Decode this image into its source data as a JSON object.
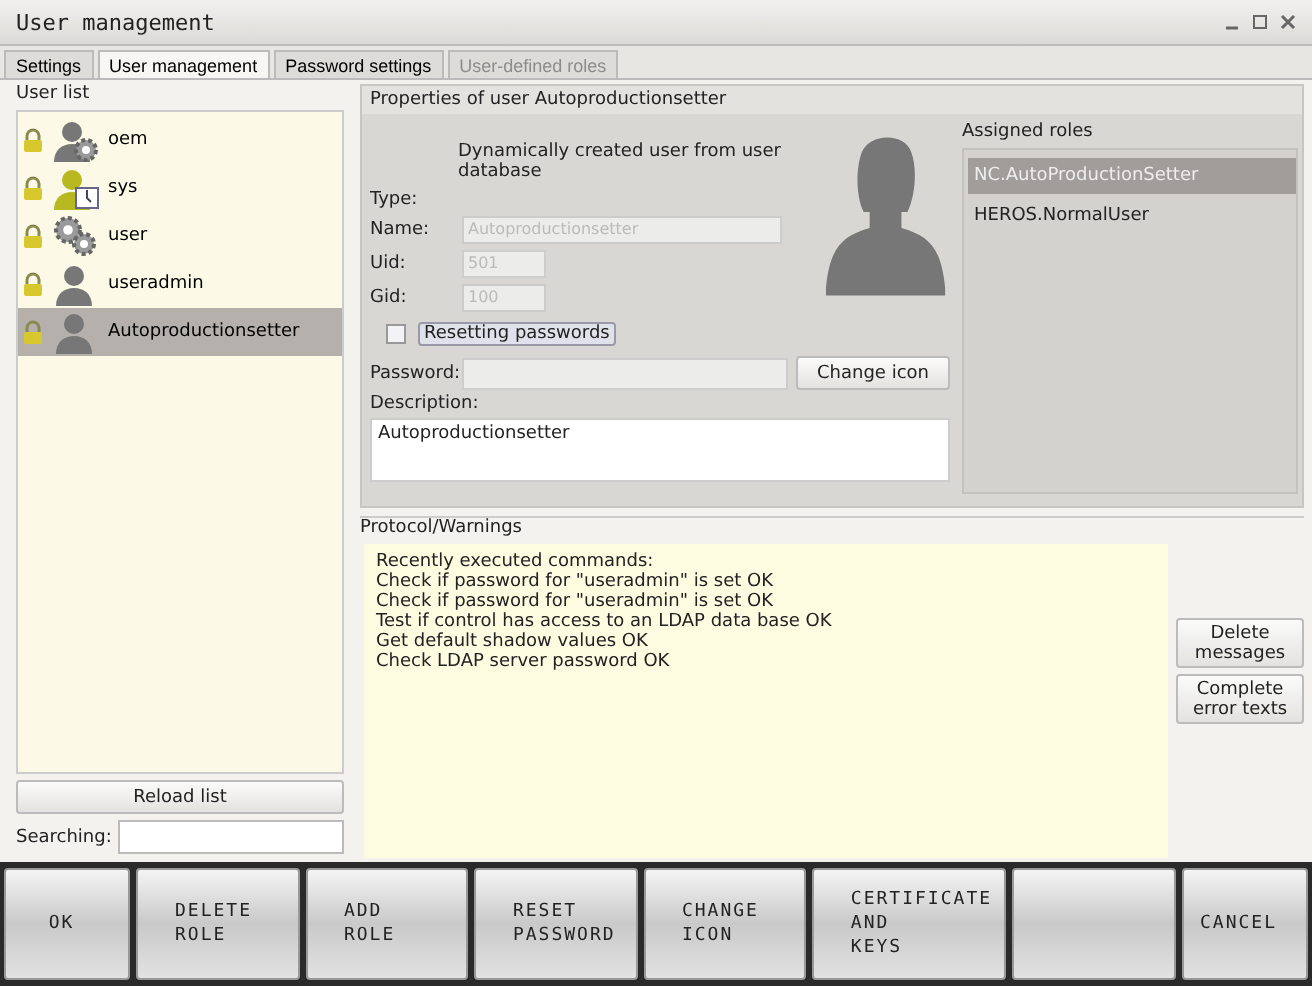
{
  "window": {
    "title": "User management"
  },
  "tabs": [
    {
      "label": "Settings",
      "selected": false,
      "disabled": false
    },
    {
      "label": "User management",
      "selected": true,
      "disabled": false
    },
    {
      "label": "Password settings",
      "selected": false,
      "disabled": false
    },
    {
      "label": "User-defined roles",
      "selected": false,
      "disabled": true
    }
  ],
  "user_list": {
    "title": "User list",
    "items": [
      {
        "name": "oem",
        "kind": "person-gear",
        "selected": false
      },
      {
        "name": "sys",
        "kind": "person-clock",
        "selected": false
      },
      {
        "name": "user",
        "kind": "gears",
        "selected": false
      },
      {
        "name": "useradmin",
        "kind": "person",
        "selected": false
      },
      {
        "name": "Autoproductionsetter",
        "kind": "person",
        "selected": true
      }
    ],
    "reload_button": "Reload list",
    "search_label": "Searching:"
  },
  "properties": {
    "title": "Properties of user Autoproductionsetter",
    "type_label": "Type:",
    "type_value": "Dynamically created user from user database",
    "fields": [
      {
        "label": "Name:",
        "value": "Autoproductionsetter",
        "disabled": true
      },
      {
        "label": "Uid:",
        "value": "501",
        "disabled": true
      },
      {
        "label": "Gid:",
        "value": "100",
        "disabled": true
      }
    ],
    "reset_checkbox": {
      "label": "Resetting passwords",
      "checked": false
    },
    "password_label": "Password:",
    "change_icon_button": "Change icon",
    "description_label": "Description:",
    "description": "Autoproductionsetter",
    "roles_title": "Assigned roles",
    "roles": [
      {
        "name": "NC.AutoProductionSetter",
        "selected": true
      },
      {
        "name": "HEROS.NormalUser",
        "selected": false
      }
    ]
  },
  "protocol": {
    "title": "Protocol/Warnings",
    "lines": [
      "Recently executed commands:",
      "Check if password for \"useradmin\" is set OK",
      "Check if password for \"useradmin\" is set OK",
      "Test if control has access to an LDAP data base OK",
      "Get default shadow values OK",
      "Check LDAP server password OK"
    ],
    "buttons": [
      [
        "Delete",
        "messages"
      ],
      [
        "Complete",
        "error texts"
      ]
    ]
  },
  "softkeys": [
    {
      "kind": "label",
      "lines": [
        "OK"
      ]
    },
    {
      "kind": "label",
      "lines": [
        "DELETE",
        "ROLE"
      ]
    },
    {
      "kind": "label",
      "lines": [
        "ADD",
        "ROLE"
      ]
    },
    {
      "kind": "label",
      "lines": [
        "RESET",
        "PASSWORD"
      ]
    },
    {
      "kind": "label",
      "lines": [
        "CHANGE",
        "ICON"
      ]
    },
    {
      "kind": "label",
      "lines": [
        "CERTIFICATE",
        "AND",
        "KEYS"
      ]
    },
    {
      "kind": "blank"
    },
    {
      "kind": "label",
      "lines": [
        "CANCEL"
      ]
    }
  ]
}
